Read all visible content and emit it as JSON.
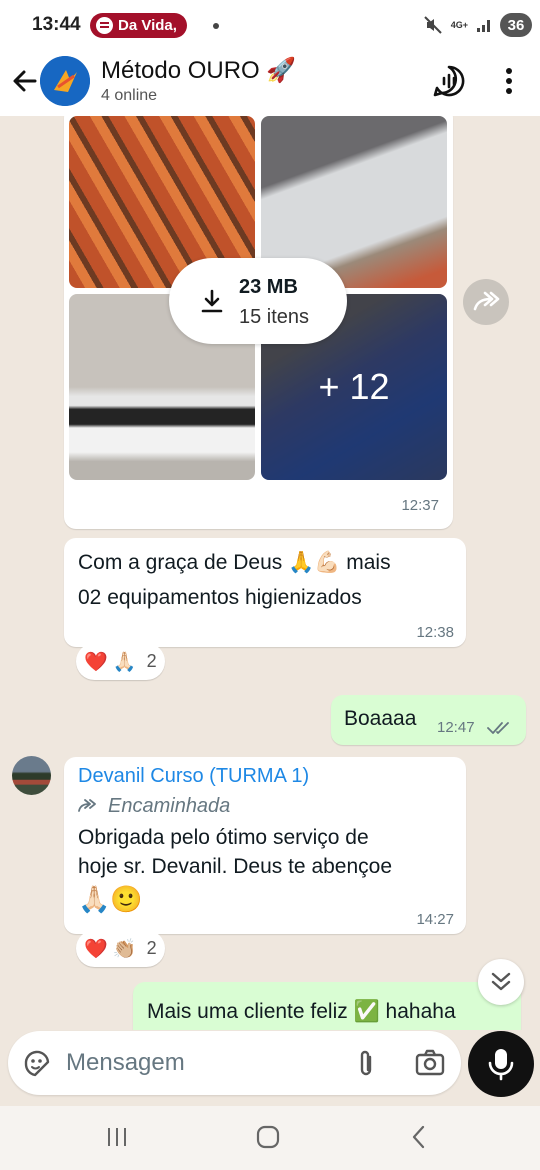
{
  "status_bar": {
    "time": "13:44",
    "spotify_label": "Da Vida,",
    "network": "4G+",
    "battery": "36"
  },
  "header": {
    "title": "Método OURO 🚀",
    "subtitle": "4 online"
  },
  "messages": {
    "album": {
      "size": "23 MB",
      "count": "15 itens",
      "more": "+ 12",
      "time": "12:37"
    },
    "m1": {
      "line1": "Com a graça de Deus 🙏💪🏻 mais",
      "line2": "02 equipamentos higienizados",
      "time": "12:38",
      "reactions": {
        "emojis": "❤️ 🙏🏻",
        "count": "2"
      }
    },
    "m2": {
      "text": "Boaaaa",
      "time": "12:47"
    },
    "m3": {
      "sender": "Devanil Curso (TURMA 1)",
      "forwarded": "Encaminhada",
      "line1": "Obrigada pelo ótimo serviço de",
      "line2": "hoje sr. Devanil. Deus te abençoe",
      "line3": "🙏🏻🙂",
      "time": "14:27",
      "reactions": {
        "emojis": "❤️ 👏🏼",
        "count": "2"
      }
    },
    "m4": {
      "text": "Mais uma cliente feliz ✅ hahaha"
    }
  },
  "input": {
    "placeholder": "Mensagem"
  },
  "colors": {
    "chat_bg": "#efe7de",
    "outgoing": "#d9fdd3",
    "sender_name": "#1e88e5",
    "spotify_pill": "#a3102a"
  }
}
